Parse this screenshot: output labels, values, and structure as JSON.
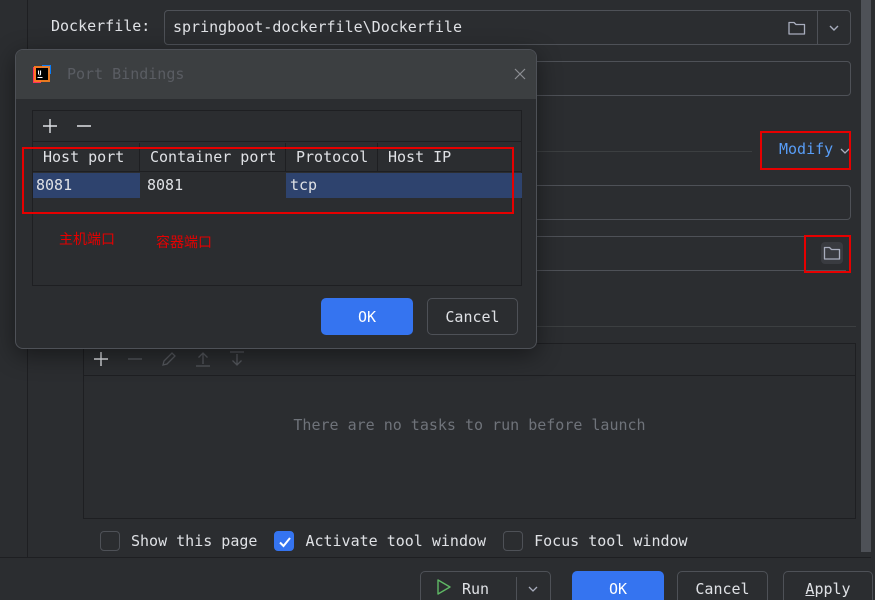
{
  "background": {
    "dockerfile_label": "Dockerfile:",
    "dockerfile_value": "springboot-dockerfile\\Dockerfile",
    "modify_label": "Modify",
    "before_launch": {
      "empty_text": "There are no tasks to run before launch",
      "toolbar_icons": [
        "add-icon",
        "remove-icon",
        "edit-icon",
        "move-up-icon",
        "move-down-icon"
      ]
    },
    "checkboxes": [
      {
        "label": "Show this page",
        "checked": false
      },
      {
        "label": "Activate tool window",
        "checked": true
      },
      {
        "label": "Focus tool window",
        "checked": false
      }
    ],
    "buttons": {
      "run": "Run",
      "ok": "OK",
      "cancel": "Cancel",
      "apply_mnemonic": "A",
      "apply_rest": "pply"
    }
  },
  "dialog": {
    "title": "Port Bindings",
    "columns": [
      "Host port",
      "Container port",
      "Protocol",
      "Host IP"
    ],
    "rows": [
      {
        "host_port": "8081",
        "container_port": "8081",
        "protocol": "tcp",
        "host_ip": ""
      }
    ],
    "annotations": {
      "host_port": "主机端口",
      "container_port": "容器端口"
    },
    "ok_label": "OK",
    "cancel_label": "Cancel"
  },
  "colors": {
    "accent": "#3574f0",
    "link": "#589df6",
    "annotation_red": "#e60000",
    "selection": "#2e436e",
    "run_green": "#5fb865"
  }
}
